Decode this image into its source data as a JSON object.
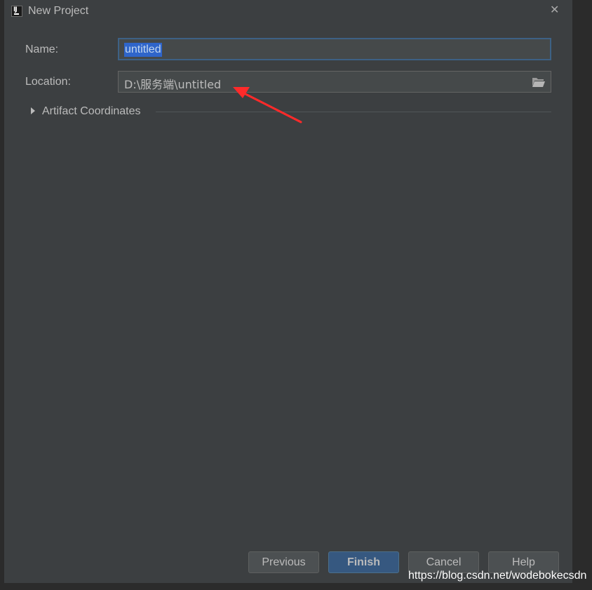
{
  "window": {
    "title": "New Project",
    "close_glyph": "✕",
    "app_icon": "intellij-icon",
    "app_icon_text": "IJ"
  },
  "form": {
    "name_label": "Name:",
    "name_value": "untitled",
    "location_label": "Location:",
    "location_value": "D:\\服务端\\untitled",
    "browse_icon": "folder-open-icon",
    "artifact_label": "Artifact Coordinates",
    "artifact_expanded": false
  },
  "buttons": {
    "previous": "Previous",
    "finish": "Finish",
    "cancel": "Cancel",
    "help": "Help"
  },
  "annotation": {
    "arrow_color": "#ff2a2a"
  },
  "watermark": "https://blog.csdn.net/wodebokecsdn",
  "colors": {
    "dialog_bg": "#3c3f41",
    "field_bg": "#45494a",
    "focus_border": "#3d6185",
    "selection": "#2f65ca",
    "primary_button": "#365880"
  }
}
